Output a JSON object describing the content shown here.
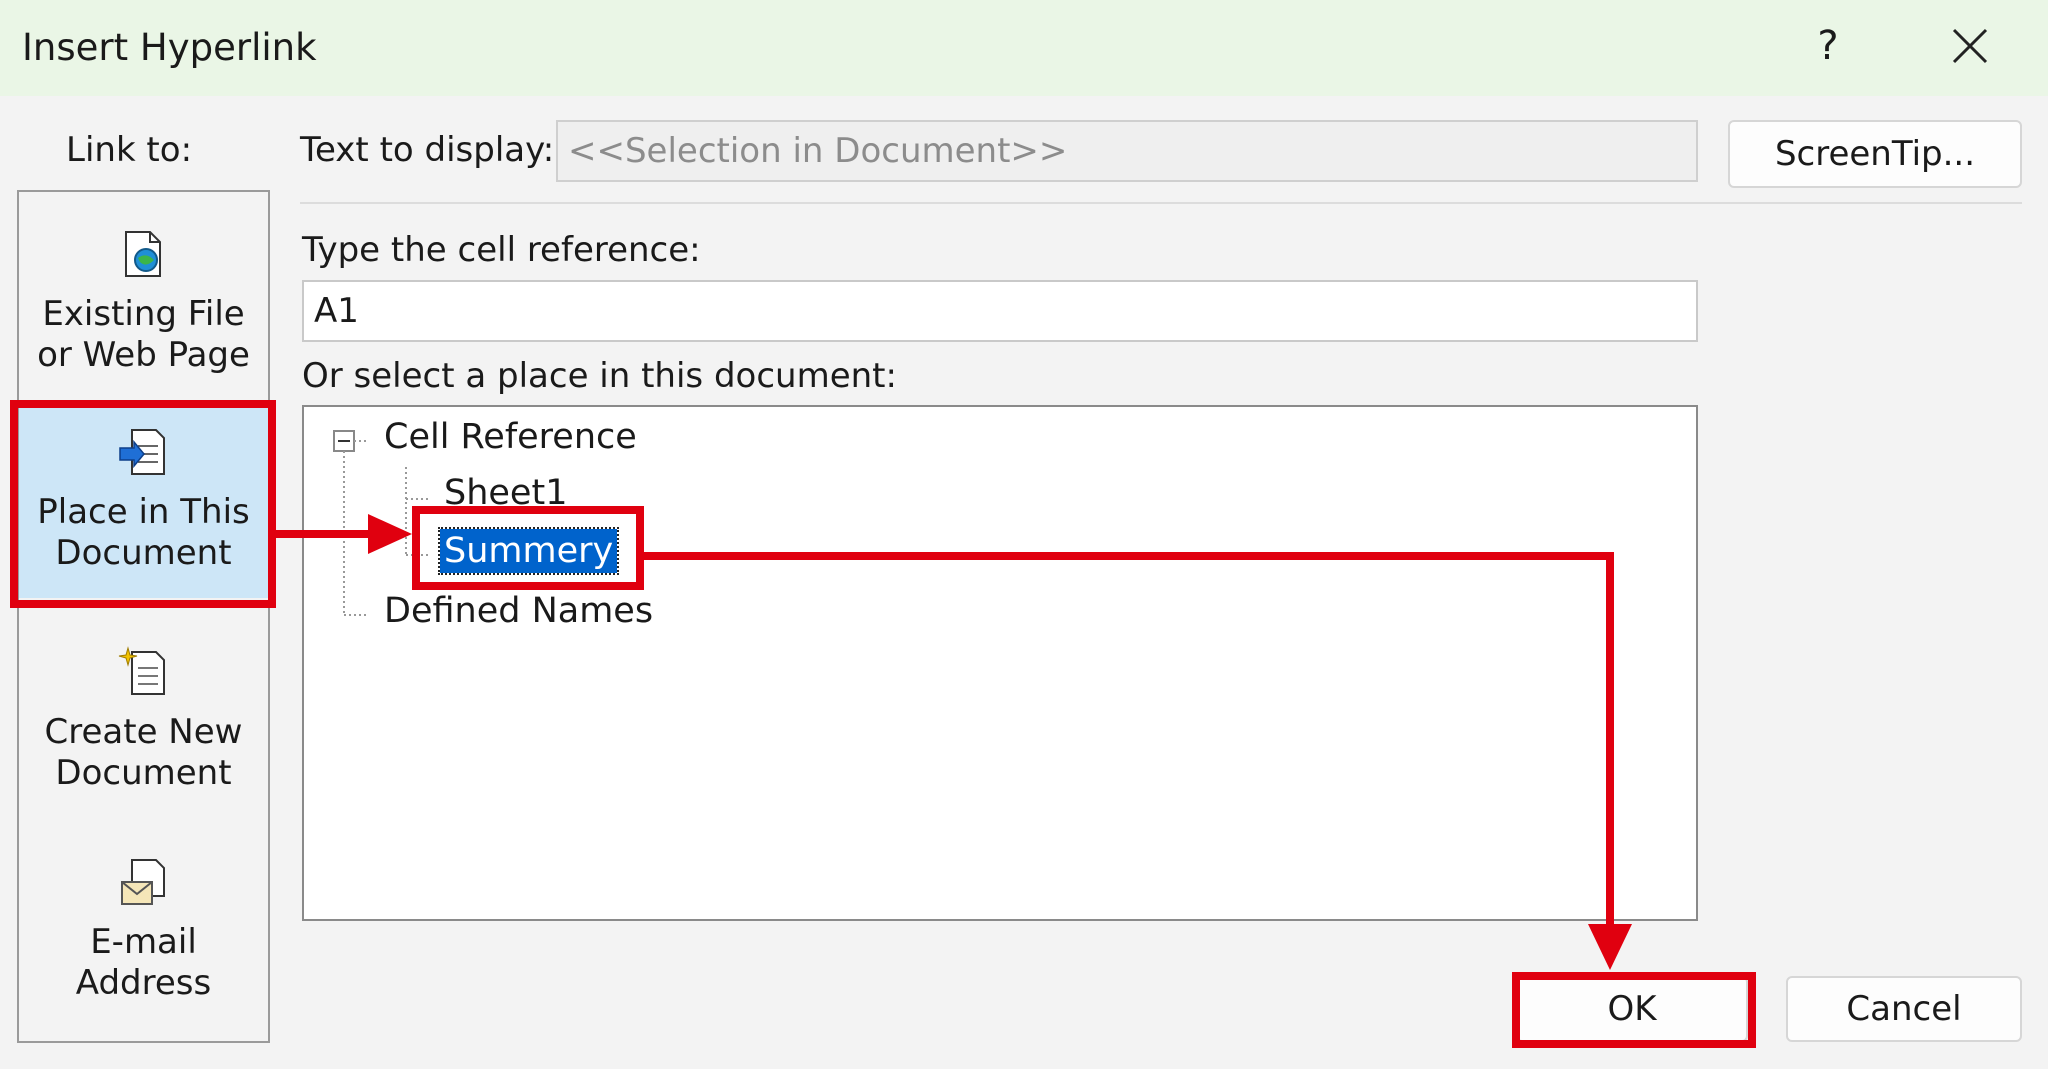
{
  "window": {
    "title": "Insert Hyperlink",
    "help_label": "?"
  },
  "link_to": {
    "label": "Link to:",
    "items": [
      {
        "line1": "Existing File",
        "line2": "or Web Page",
        "icon": "web-page-icon"
      },
      {
        "line1": "Place in This",
        "line2": "Document",
        "icon": "place-in-document-icon",
        "selected": true
      },
      {
        "line1": "Create New",
        "line2": "Document",
        "icon": "new-document-icon"
      },
      {
        "line1": "E-mail",
        "line2": "Address",
        "icon": "email-icon"
      }
    ]
  },
  "text_to_display": {
    "label": "Text to display:",
    "value": "<<Selection in Document>>"
  },
  "screentip_label": "ScreenTip...",
  "cell_reference": {
    "label": "Type the cell reference:",
    "value": "A1"
  },
  "place": {
    "label": "Or select a place in this document:",
    "tree": {
      "root": "Cell Reference",
      "children": [
        "Sheet1",
        "Summery"
      ],
      "selected": "Summery",
      "defined_names": "Defined Names"
    }
  },
  "buttons": {
    "ok": "OK",
    "cancel": "Cancel"
  },
  "colors": {
    "annotation_red": "#e0000f",
    "selection_blue": "#0063cc",
    "titlebar_green": "#eaf6e6",
    "selected_nav": "#cde6f7"
  }
}
